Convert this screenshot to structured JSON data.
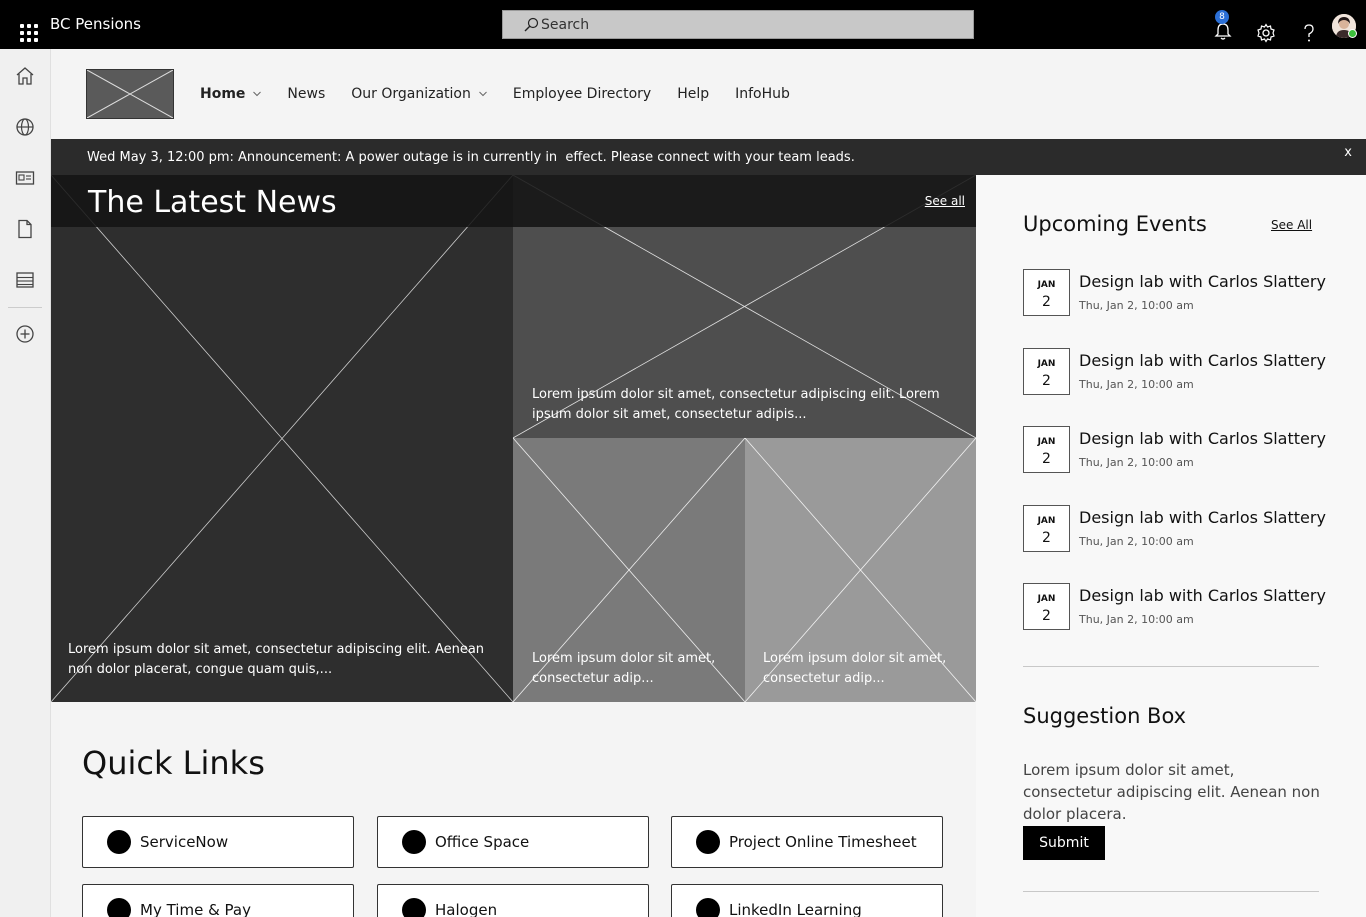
{
  "suite": {
    "app_name": "BC Pensions",
    "search_placeholder": "Search",
    "notification_count": "8"
  },
  "icons": [
    "app-launcher-icon",
    "search-icon",
    "bell-icon",
    "gear-icon",
    "help-icon",
    "home-icon",
    "globe-icon",
    "news-icon",
    "document-icon",
    "list-icon",
    "add-icon",
    "chevron-down-icon"
  ],
  "nav": {
    "items": [
      {
        "label": "Home",
        "has_menu": true
      },
      {
        "label": "News",
        "has_menu": false
      },
      {
        "label": "Our Organization",
        "has_menu": true
      },
      {
        "label": "Employee Directory",
        "has_menu": false
      },
      {
        "label": "Help",
        "has_menu": false
      },
      {
        "label": "InfoHub",
        "has_menu": false
      }
    ]
  },
  "announcement": {
    "text": "Wed May 3, 12:00 pm: Announcement: A power outage is in currently in  effect. Please connect with your team leads.",
    "close_label": "x"
  },
  "news": {
    "title": "The Latest News",
    "see_all": "See all",
    "tiles": [
      {
        "caption": "Lorem ipsum dolor sit amet, consectetur adipiscing elit. Aenean non dolor placerat, congue quam quis,..."
      },
      {
        "caption": "Lorem ipsum dolor sit amet, consectetur adipiscing elit. Lorem ipsum dolor sit amet, consectetur adipis..."
      },
      {
        "caption": "Lorem ipsum dolor sit amet, consectetur adip..."
      },
      {
        "caption": "Lorem ipsum dolor sit amet, consectetur adip..."
      }
    ]
  },
  "quick_links": {
    "title": "Quick Links",
    "items": [
      "ServiceNow",
      "Office Space",
      "Project Online Timesheet",
      "My Time & Pay",
      "Halogen",
      "LinkedIn Learning"
    ]
  },
  "events": {
    "title": "Upcoming Events",
    "see_all": "See All",
    "items": [
      {
        "month": "JAN",
        "day": "2",
        "title": "Design lab with Carlos Slattery",
        "time": "Thu, Jan 2, 10:00 am"
      },
      {
        "month": "JAN",
        "day": "2",
        "title": "Design lab with Carlos Slattery",
        "time": "Thu, Jan 2, 10:00 am"
      },
      {
        "month": "JAN",
        "day": "2",
        "title": "Design lab with Carlos Slattery",
        "time": "Thu, Jan 2, 10:00 am"
      },
      {
        "month": "JAN",
        "day": "2",
        "title": "Design lab with Carlos Slattery",
        "time": "Thu, Jan 2, 10:00 am"
      },
      {
        "month": "JAN",
        "day": "2",
        "title": "Design lab with Carlos Slattery",
        "time": "Thu, Jan 2, 10:00 am"
      }
    ]
  },
  "suggestion": {
    "title": "Suggestion Box",
    "text": "Lorem ipsum dolor sit amet, consectetur adipiscing elit. Aenean non dolor placera.",
    "submit_label": "Submit"
  }
}
